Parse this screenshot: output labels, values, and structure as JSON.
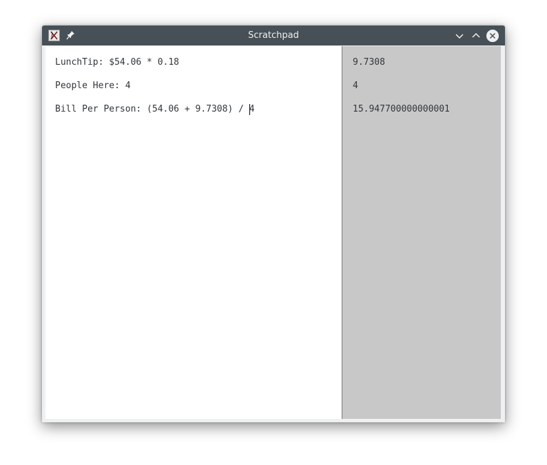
{
  "window": {
    "title": "Scratchpad",
    "icons": {
      "app": "app-logo-icon",
      "pin": "pin-icon",
      "minimize": "chevron-down-icon",
      "maximize": "chevron-up-icon",
      "close": "close-icon"
    },
    "colors": {
      "titlebar": "#475057",
      "results_background": "#c8c8c8",
      "editor_background": "#ffffff",
      "text": "#31363b"
    }
  },
  "editor": {
    "lines": [
      "LunchTip: $54.06 * 0.18",
      "People Here: 4",
      "Bill Per Person: (54.06 + 9.7308) / 4"
    ]
  },
  "results": {
    "lines": [
      "9.7308",
      "4",
      "15.947700000000001"
    ]
  }
}
